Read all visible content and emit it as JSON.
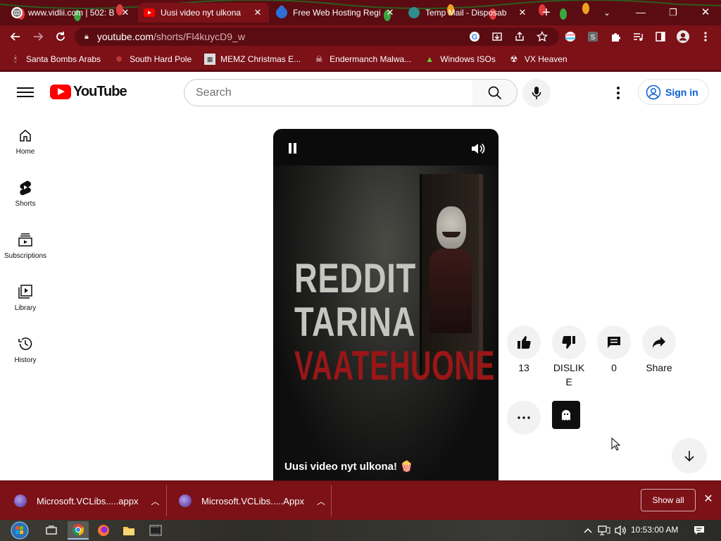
{
  "browser": {
    "tabs": [
      {
        "title": "www.vidlii.com | 502: B",
        "icon": "globe-icon"
      },
      {
        "title": "Uusi video nyt ulkona",
        "icon": "youtube-icon",
        "active": true
      },
      {
        "title": "Free Web Hosting Regi",
        "icon": "hosting-icon"
      },
      {
        "title": "Temp Mail - Disposab",
        "icon": "tempmail-icon"
      }
    ],
    "url_host": "youtube.com",
    "url_path": "/shorts/Fl4kuycD9_w",
    "bookmarks": [
      {
        "label": "Santa Bombs Arabs",
        "icon": "santa-icon"
      },
      {
        "label": "South Hard Pole",
        "icon": "snowflake-icon"
      },
      {
        "label": "MEMZ Christmas E...",
        "icon": "memz-icon"
      },
      {
        "label": "Endermanch Malwa...",
        "icon": "skull-icon"
      },
      {
        "label": "Windows ISOs",
        "icon": "tree-icon"
      },
      {
        "label": "VX Heaven",
        "icon": "vx-icon"
      }
    ],
    "accent": "#7c1117"
  },
  "youtube": {
    "logo_text": "YouTube",
    "search_placeholder": "Search",
    "sign_in": "Sign in",
    "sidebar": [
      {
        "label": "Home",
        "icon": "home-icon"
      },
      {
        "label": "Shorts",
        "icon": "shorts-icon"
      },
      {
        "label": "Subscriptions",
        "icon": "subscriptions-icon"
      },
      {
        "label": "Library",
        "icon": "library-icon"
      },
      {
        "label": "History",
        "icon": "history-icon"
      }
    ],
    "short": {
      "overlay_line1": "REDDIT",
      "overlay_line2": "TARINA",
      "overlay_line3": "VAATEHUONE",
      "caption": "Uusi video nyt ulkona! 🍿"
    },
    "actions": {
      "like_count": "13",
      "dislike_label_1": "DISLIK",
      "dislike_label_2": "E",
      "comment_count": "0",
      "share_label": "Share"
    }
  },
  "downloads": {
    "items": [
      {
        "name": "Microsoft.VCLibs.....appx"
      },
      {
        "name": "Microsoft.VCLibs.....Appx"
      }
    ],
    "show_all": "Show all"
  },
  "taskbar": {
    "time": "10:53:00 AM"
  }
}
